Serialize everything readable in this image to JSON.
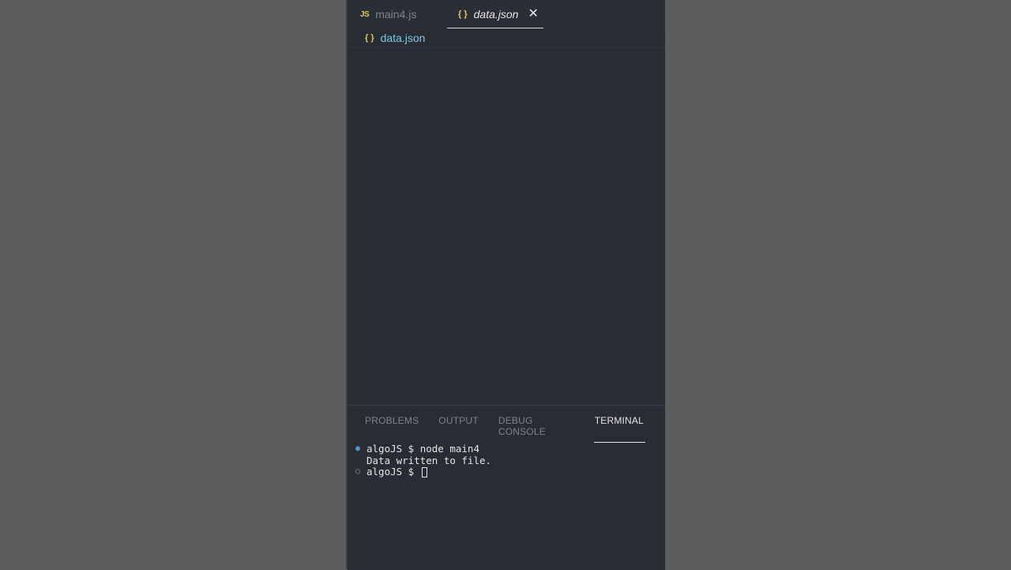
{
  "tabs": [
    {
      "icon_text": "JS",
      "label": "main4.js"
    },
    {
      "icon_text": "{ }",
      "label": "data.json",
      "close_glyph": "✕"
    }
  ],
  "breadcrumb": {
    "icon_text": "{ }",
    "label": "data.json"
  },
  "panel": {
    "tabs": [
      "PROBLEMS",
      "OUTPUT",
      "DEBUG CONSOLE",
      "TERMINAL"
    ],
    "active_tab": "TERMINAL"
  },
  "terminal": {
    "lines": [
      {
        "marker": "●",
        "text": "algoJS $ node main4"
      },
      {
        "marker": "",
        "text": "Data written to file."
      },
      {
        "marker": "○",
        "text": "algoJS $ "
      }
    ]
  },
  "colors": {
    "background": "#5b5c5e",
    "editor_bg": "#282c33",
    "accent_blue": "#4c95c7",
    "icon_yellow": "#e3c65a",
    "breadcrumb_blue": "#7ec7e8"
  }
}
